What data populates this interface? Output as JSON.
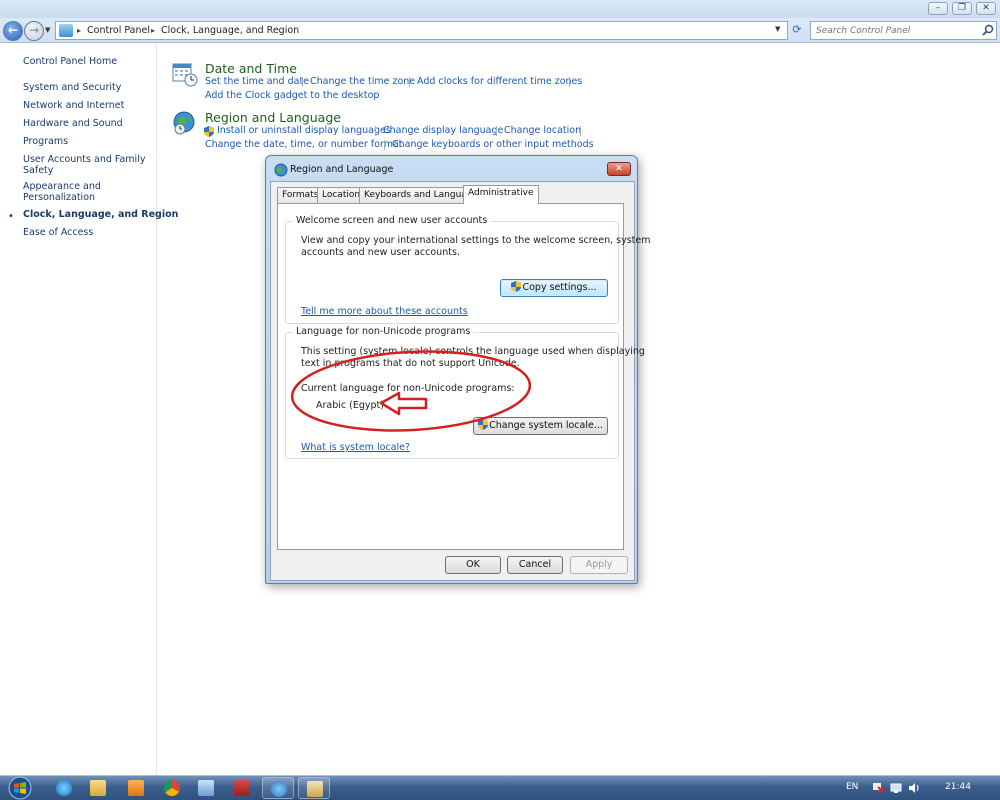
{
  "window": {
    "min_label": "–",
    "max_label": "❐",
    "close_label": "✕"
  },
  "address_bar": {
    "breadcrumbs": [
      "Control Panel",
      "Clock, Language, and Region"
    ],
    "search_placeholder": "Search Control Panel"
  },
  "sidebar": {
    "home": "Control Panel Home",
    "items": [
      "System and Security",
      "Network and Internet",
      "Hardware and Sound",
      "Programs",
      "User Accounts and Family Safety",
      "Appearance and Personalization",
      "Clock, Language, and Region",
      "Ease of Access"
    ],
    "current": "Clock, Language, and Region"
  },
  "categories": {
    "date_time": {
      "title": "Date and Time",
      "links": [
        "Set the time and date",
        "Change the time zone",
        "Add clocks for different time zones",
        "Add the Clock gadget to the desktop"
      ]
    },
    "region_language": {
      "title": "Region and Language",
      "links": [
        "Install or uninstall display languages",
        "Change display language",
        "Change location",
        "Change the date, time, or number format",
        "Change keyboards or other input methods"
      ]
    }
  },
  "dialog": {
    "title": "Region and Language",
    "close_label": "✕",
    "tabs": [
      "Formats",
      "Location",
      "Keyboards and Languages",
      "Administrative"
    ],
    "active_tab": "Administrative",
    "welcome_group": {
      "title": "Welcome screen and new user accounts",
      "description_line1": "View and copy your international settings to the welcome screen, system",
      "description_line2": "accounts and new user accounts.",
      "button": "Copy settings...",
      "link": "Tell me more about these accounts"
    },
    "nonunicode_group": {
      "title": "Language for non-Unicode programs",
      "description_line1": "This setting (system locale) controls the language used when displaying",
      "description_line2": "text in programs that do not support Unicode.",
      "current_label": "Current language for non-Unicode programs:",
      "current_value": "Arabic (Egypt)",
      "button": "Change system locale...",
      "link": "What is system locale?"
    },
    "ok": "OK",
    "cancel": "Cancel",
    "apply": "Apply"
  },
  "taskbar": {
    "apps": [
      "internet-explorer",
      "windows-explorer",
      "media-player",
      "chrome",
      "remote-desktop",
      "access",
      "region-control-panel",
      "misc-app"
    ],
    "language": "EN",
    "time": "21:44"
  },
  "colors": {
    "link": "#1a5ab0",
    "category_title": "#1e5f1e",
    "annotation": "#d42020",
    "taskbar": "#3c5f8d"
  }
}
